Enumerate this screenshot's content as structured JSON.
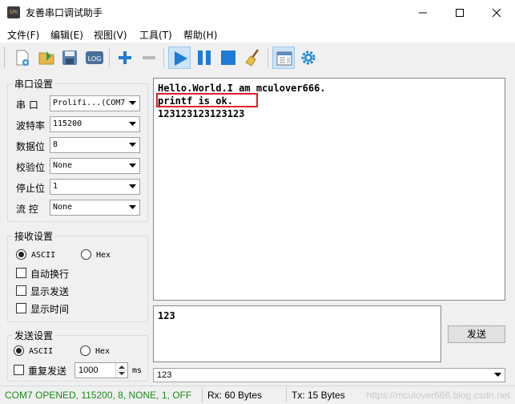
{
  "window": {
    "title": "友善串口调试助手",
    "icon_text": "SPU"
  },
  "menu": [
    {
      "label": "文件(F)"
    },
    {
      "label": "编辑(E)"
    },
    {
      "label": "视图(V)"
    },
    {
      "label": "工具(T)"
    },
    {
      "label": "帮助(H)"
    }
  ],
  "toolbar": {
    "icons": [
      "new-file-icon",
      "open-folder-icon",
      "save-icon",
      "log-icon",
      "plus-icon",
      "minus-icon",
      "play-icon",
      "pause-icon",
      "stop-icon",
      "broom-icon",
      "panel-icon",
      "gear-icon"
    ],
    "log_text": "LOG"
  },
  "serial": {
    "title": "串口设置",
    "port_label": "串  口",
    "port_value": "Prolifi...(COM7",
    "baud_label": "波特率",
    "baud_value": "115200",
    "databits_label": "数据位",
    "databits_value": "8",
    "parity_label": "校验位",
    "parity_value": "None",
    "stopbits_label": "停止位",
    "stopbits_value": "1",
    "flow_label": "流  控",
    "flow_value": "None"
  },
  "recv_settings": {
    "title": "接收设置",
    "ascii_label": "ASCII",
    "hex_label": "Hex",
    "mode": "ASCII",
    "wrap_label": "自动换行",
    "show_send_label": "显示发送",
    "show_time_label": "显示时间"
  },
  "send_settings": {
    "title": "发送设置",
    "ascii_label": "ASCII",
    "hex_label": "Hex",
    "mode": "ASCII",
    "repeat_label": "重复发送",
    "interval_value": "1000",
    "interval_unit": "ms"
  },
  "receive": {
    "lines": [
      "Hello.World.I am mculover666.",
      "printf is ok.",
      "123123123123123"
    ]
  },
  "send": {
    "text": "123",
    "button_label": "发送",
    "history_value": "123"
  },
  "status": {
    "connection": "COM7 OPENED, 115200, 8, NONE, 1, OFF",
    "rx": "Rx: 60 Bytes",
    "tx": "Tx: 15 Bytes",
    "watermark": "https://mculover666.blog.csdn.net"
  },
  "colors": {
    "status_ok": "#1a8a1a",
    "highlight_border": "#e0202a",
    "toolbar_blue": "#1e7bd6"
  }
}
